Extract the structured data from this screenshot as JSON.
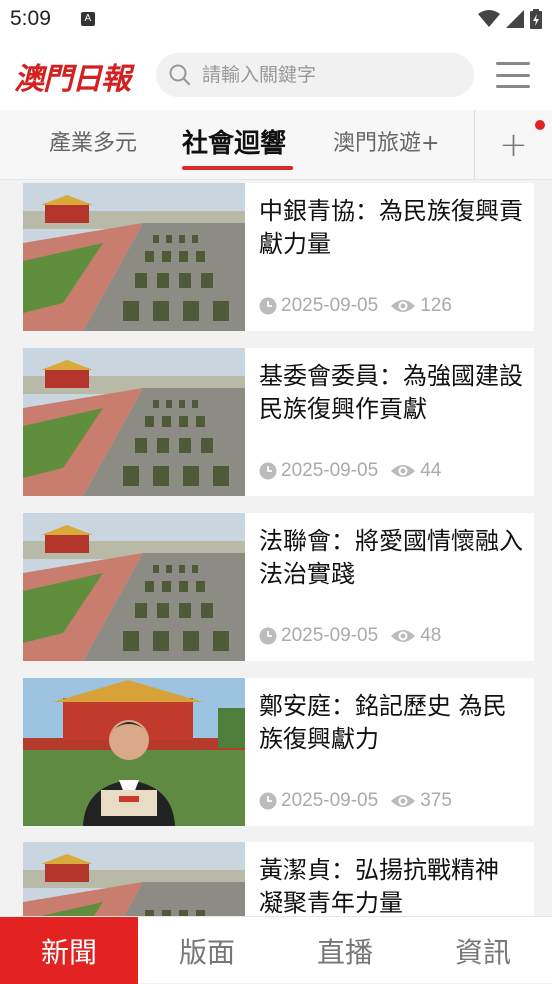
{
  "status": {
    "time": "5:09",
    "notif_icon": "A"
  },
  "header": {
    "logo_text": "澳門日報",
    "search_placeholder": "請輸入關鍵字"
  },
  "tabs": {
    "items": [
      {
        "label": "產業多元"
      },
      {
        "label": "社會迴響"
      },
      {
        "label": "澳門旅遊+"
      }
    ],
    "active_index": 1,
    "plus_label": "+"
  },
  "articles": [
    {
      "title": "中銀青協：為民族復興貢獻力量",
      "date": "2025-09-05",
      "views": "126",
      "image": "parade"
    },
    {
      "title": "基委會委員：為強國建設民族復興作貢獻",
      "date": "2025-09-05",
      "views": "44",
      "image": "parade"
    },
    {
      "title": "法聯會：將愛國情懷融入法治實踐",
      "date": "2025-09-05",
      "views": "48",
      "image": "parade"
    },
    {
      "title": "鄭安庭：銘記歷史 為民族復興獻力",
      "date": "2025-09-05",
      "views": "375",
      "image": "portrait"
    },
    {
      "title": "黃潔貞：弘揚抗戰精神 凝聚青年力量",
      "date": "",
      "views": "",
      "image": "parade"
    }
  ],
  "bottom_nav": [
    {
      "label": "新聞"
    },
    {
      "label": "版面"
    },
    {
      "label": "直播"
    },
    {
      "label": "資訊"
    }
  ],
  "colors": {
    "accent": "#e32222",
    "tab_underline": "#d82a2a"
  }
}
